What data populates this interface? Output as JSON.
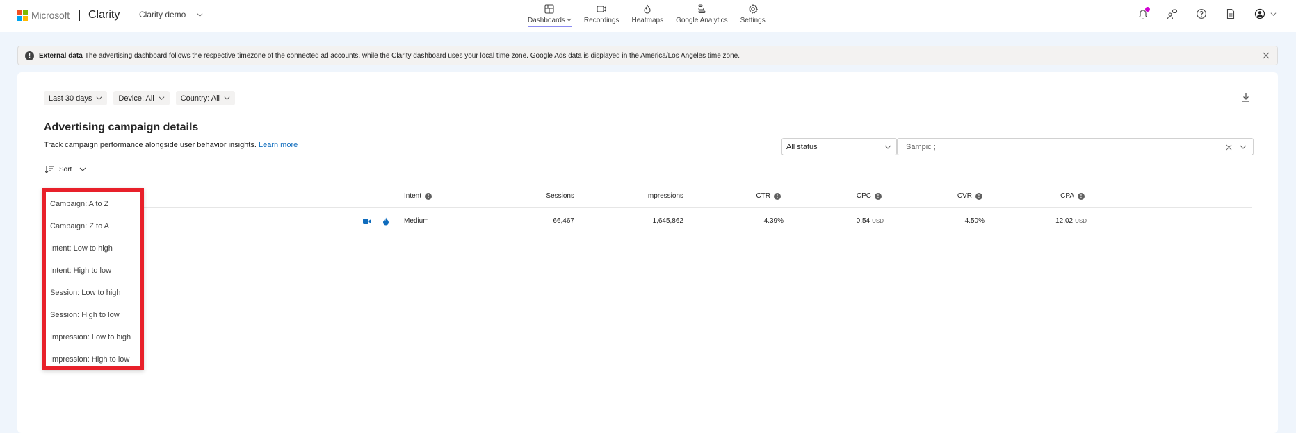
{
  "brand": {
    "company": "Microsoft",
    "product": "Clarity",
    "logo_colors": [
      "#f25022",
      "#7fba00",
      "#00a4ef",
      "#ffb900"
    ]
  },
  "project_selector": {
    "label": "Clarity demo",
    "icon": "chevron-down-icon"
  },
  "nav": {
    "items": [
      {
        "label": "Dashboards",
        "icon": "dashboard-icon",
        "active": true,
        "has_dropdown": true
      },
      {
        "label": "Recordings",
        "icon": "video-camera-icon",
        "active": false
      },
      {
        "label": "Heatmaps",
        "icon": "flame-icon",
        "active": false
      },
      {
        "label": "Google Analytics",
        "icon": "analytics-bars-icon",
        "active": false
      },
      {
        "label": "Settings",
        "icon": "gear-icon",
        "active": false
      }
    ],
    "active_underline_color": "#8b8bf0"
  },
  "top_right_icons": [
    {
      "name": "notifications-bell-icon",
      "badge": true,
      "badge_color": "#d100d1"
    },
    {
      "name": "people-feedback-icon"
    },
    {
      "name": "help-question-icon"
    },
    {
      "name": "document-icon"
    },
    {
      "name": "account-avatar-icon",
      "has_dropdown": true
    }
  ],
  "banner": {
    "icon": "info-icon",
    "title": "External data",
    "message": "The advertising dashboard follows the respective timezone of the connected ad accounts, while the Clarity dashboard uses your local time zone. Google Ads data is displayed in the America/Los Angeles time zone.",
    "close_icon": "close-icon"
  },
  "filters": [
    {
      "label": "Last 30 days"
    },
    {
      "label": "Device: All"
    },
    {
      "label": "Country: All"
    }
  ],
  "download_icon": "download-icon",
  "section": {
    "title": "Advertising campaign details",
    "description": "Track campaign performance alongside user behavior insights.",
    "learn_more": "Learn more",
    "link_color": "#0f6cbd"
  },
  "sort": {
    "label": "Sort",
    "options": [
      "Campaign: A to Z",
      "Campaign: Z to A",
      "Intent: Low to high",
      "Intent: High to low",
      "Session: Low to high",
      "Session: High to low",
      "Impression: Low to high",
      "Impression: High to low"
    ],
    "highlight_color": "#e8202a"
  },
  "status_filter": {
    "selected": "All status"
  },
  "search": {
    "value": "Sampic ;"
  },
  "table": {
    "columns": [
      {
        "key": "intent",
        "label": "Intent",
        "info": true
      },
      {
        "key": "sessions",
        "label": "Sessions",
        "info": false
      },
      {
        "key": "impressions",
        "label": "Impressions",
        "info": false
      },
      {
        "key": "ctr",
        "label": "CTR",
        "info": true
      },
      {
        "key": "cpc",
        "label": "CPC",
        "info": true
      },
      {
        "key": "cvr",
        "label": "CVR",
        "info": true
      },
      {
        "key": "cpa",
        "label": "CPA",
        "info": true
      }
    ],
    "rows": [
      {
        "row_icons": [
          "recordings-video-icon",
          "heatmap-flame-icon"
        ],
        "intent": "Medium",
        "sessions": "66,467",
        "impressions": "1,645,862",
        "ctr": "4.39%",
        "cpc": "0.54",
        "cpc_unit": "USD",
        "cvr": "4.50%",
        "cpa": "12.02",
        "cpa_unit": "USD"
      }
    ],
    "icon_color": "#0f6cbd"
  }
}
